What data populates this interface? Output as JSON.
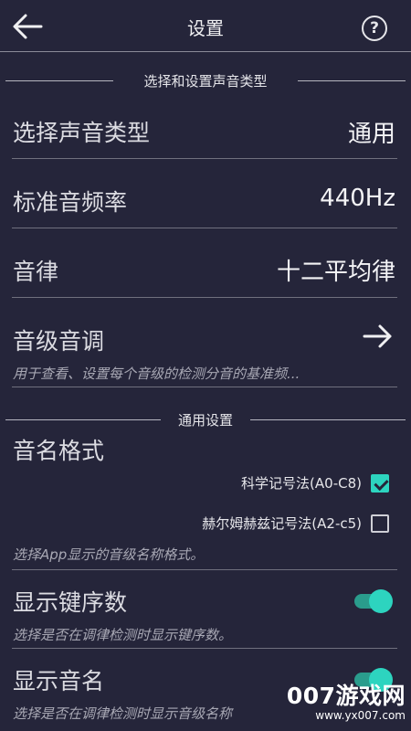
{
  "header": {
    "title": "设置",
    "help": "?"
  },
  "sections": {
    "sound": "选择和设置声音类型",
    "general": "通用设置"
  },
  "sound_type": {
    "label": "选择声音类型",
    "value": "通用"
  },
  "ref_freq": {
    "label": "标准音频率",
    "value": "440Hz"
  },
  "temperament": {
    "label": "音律",
    "value": "十二平均律"
  },
  "pitch_tuning": {
    "label": "音级音调",
    "desc": "用于查看、设置每个音级的检测分音的基准频..."
  },
  "note_format": {
    "label": "音名格式",
    "option1": {
      "label": "科学记号法(A0-C8)",
      "checked": true
    },
    "option2": {
      "label": "赫尔姆赫兹记号法(A2-c5)",
      "checked": false
    },
    "desc": "选择App显示的音级名称格式。"
  },
  "show_keys": {
    "label": "显示键序数",
    "desc": "选择是否在调律检测时显示键序数。",
    "on": true
  },
  "show_notes": {
    "label": "显示音名",
    "desc": "选择是否在调律检测时显示音级名称",
    "on": true
  },
  "watermark": {
    "title": "007游戏网",
    "url": "www.yx007.com"
  },
  "colors": {
    "background": "#25253a",
    "accent": "#2dd4bf"
  }
}
